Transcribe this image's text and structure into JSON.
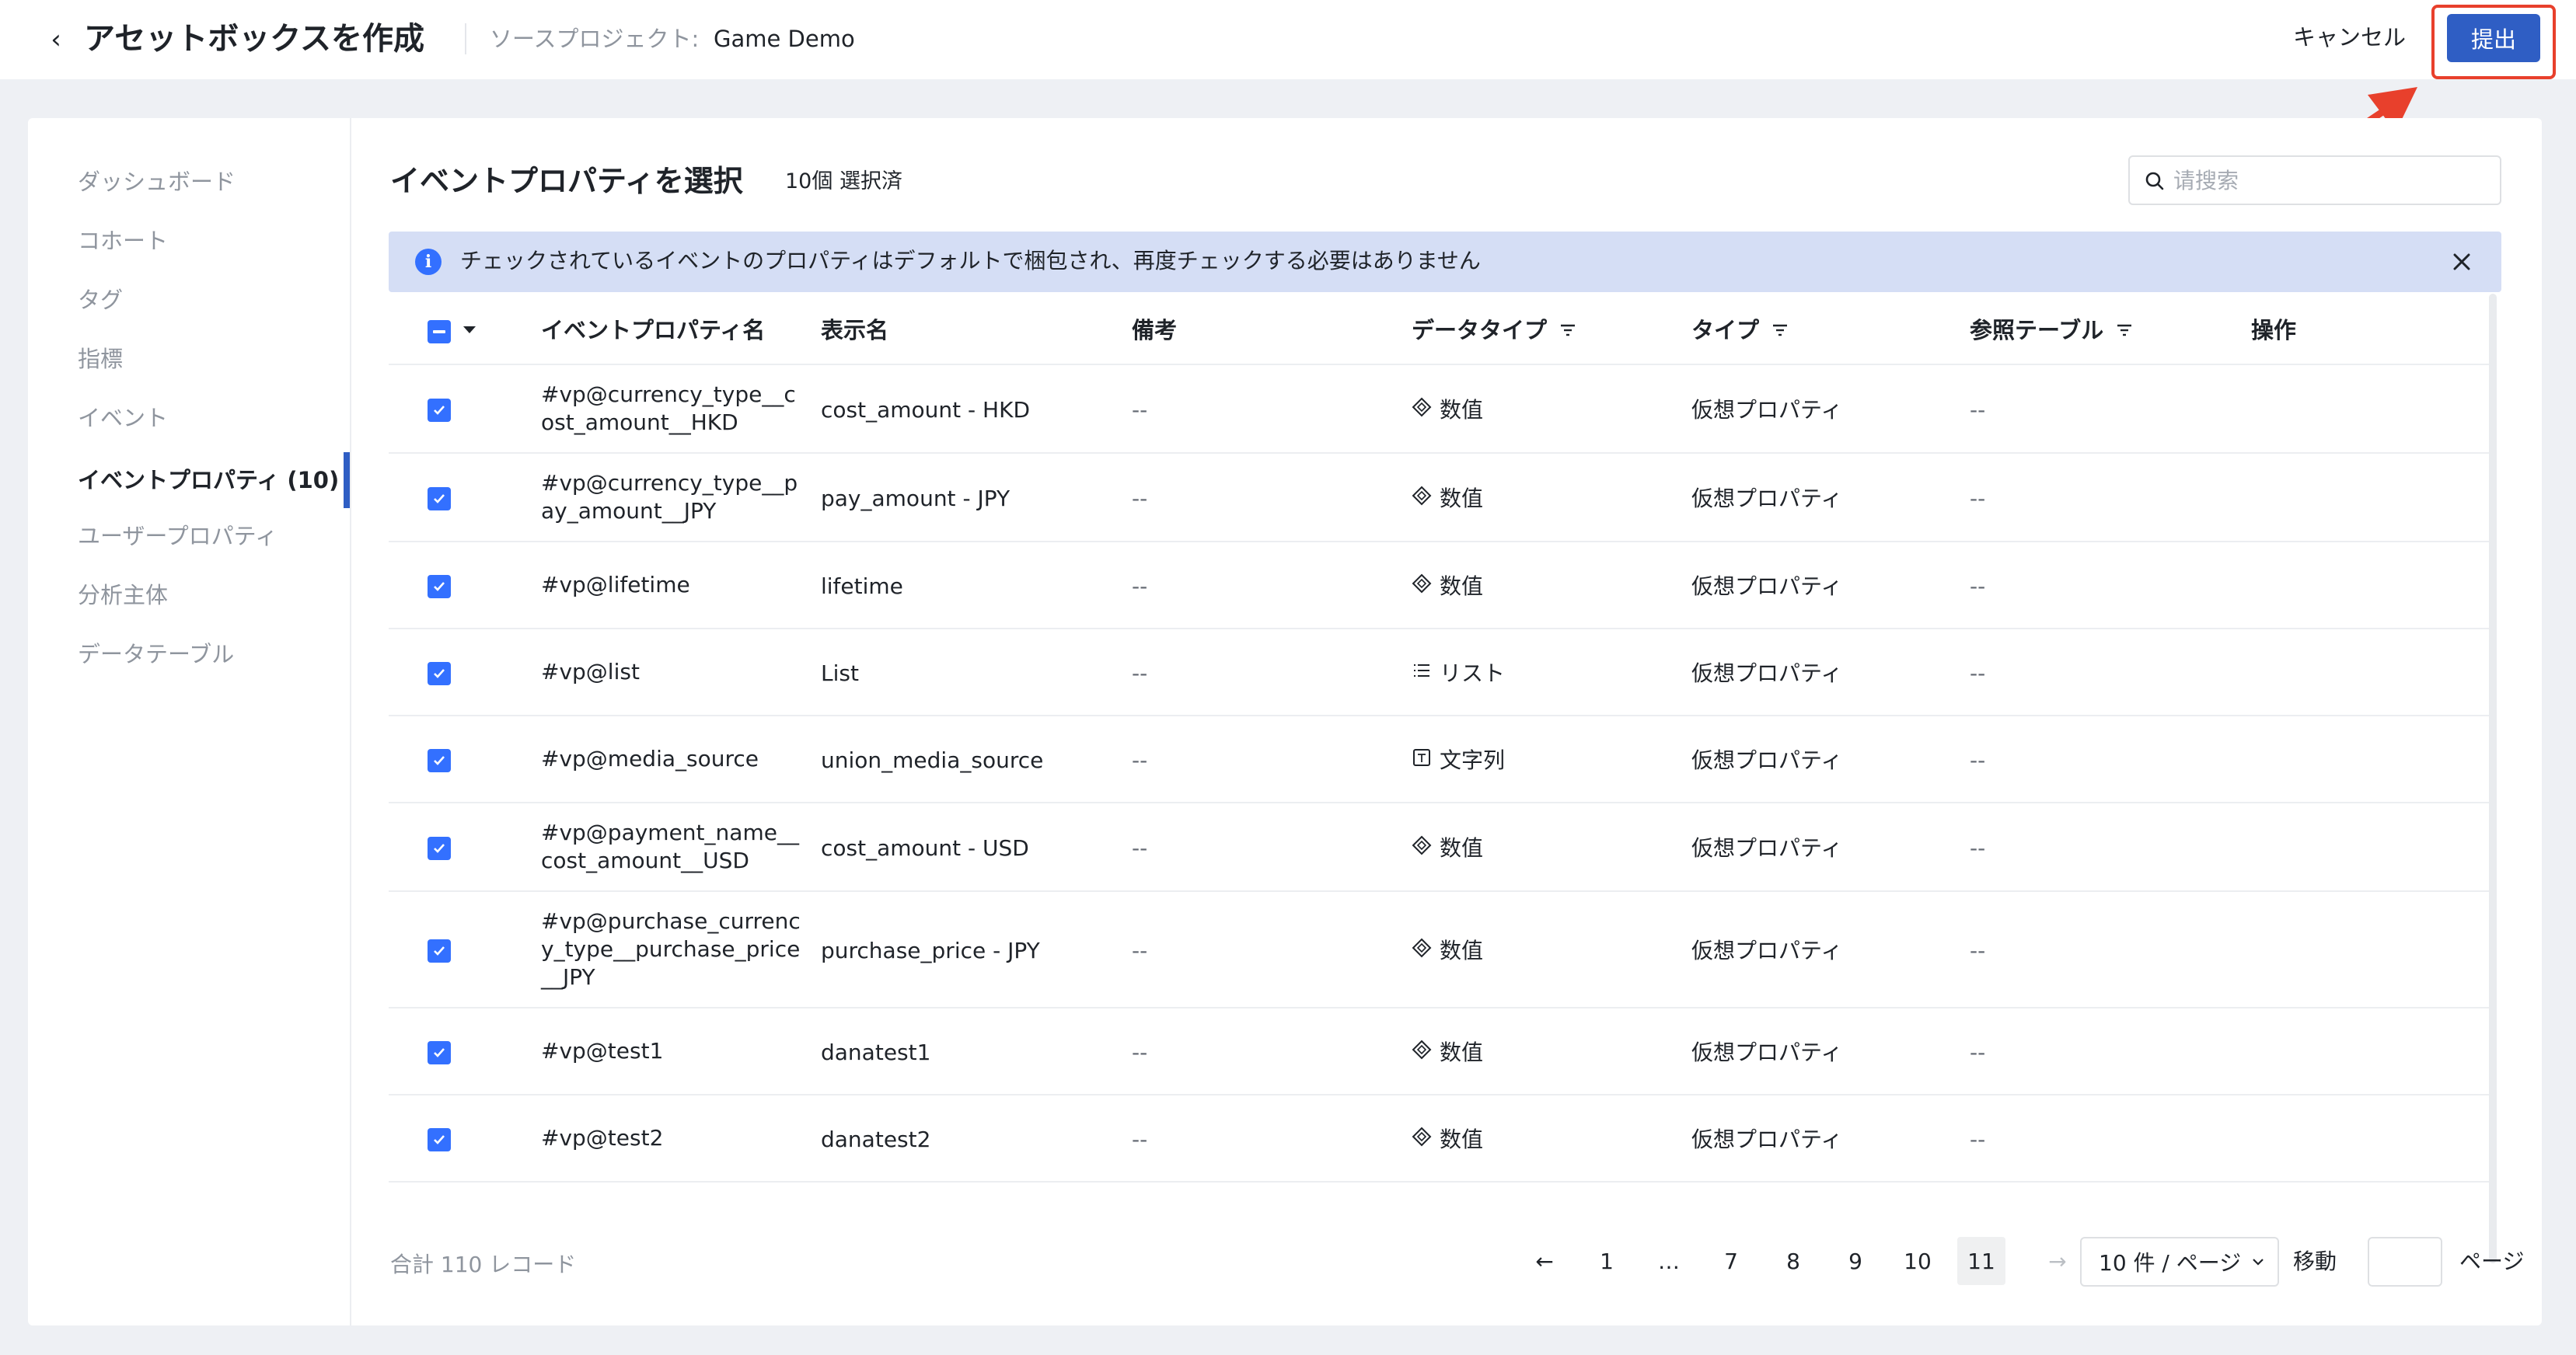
{
  "header": {
    "title": "アセットボックスを作成",
    "source_label": "ソースプロジェクト:",
    "source_value": "Game Demo",
    "cancel_label": "キャンセル",
    "submit_label": "提出"
  },
  "sidebar": {
    "items": [
      {
        "label": "ダッシュボード"
      },
      {
        "label": "コホート"
      },
      {
        "label": "タグ"
      },
      {
        "label": "指標"
      },
      {
        "label": "イベント"
      },
      {
        "label": "イベントプロパティ (10)"
      },
      {
        "label": "ユーザープロパティ"
      },
      {
        "label": "分析主体"
      },
      {
        "label": "データテーブル"
      }
    ],
    "active_index": 5
  },
  "content": {
    "title": "イベントプロパティを選択",
    "selected_count": "10個 選択済",
    "search_placeholder": "请搜索",
    "banner_text": "チェックされているイベントのプロパティはデフォルトで梱包され、再度チェックする必要はありません"
  },
  "table": {
    "headers": {
      "name": "イベントプロパティ名",
      "display": "表示名",
      "remark": "備考",
      "data_type": "データタイプ",
      "type": "タイプ",
      "ref_table": "参照テーブル",
      "action": "操作"
    },
    "rows": [
      {
        "name": "#vp@currency_type__cost_amount__HKD",
        "display": "cost_amount - HKD",
        "remark": "--",
        "data_type": "数值",
        "data_type_icon": "diamond-icon",
        "type": "仮想プロパティ",
        "ref": "--",
        "checked": true
      },
      {
        "name": "#vp@currency_type__pay_amount__JPY",
        "display": "pay_amount - JPY",
        "remark": "--",
        "data_type": "数值",
        "data_type_icon": "diamond-icon",
        "type": "仮想プロパティ",
        "ref": "--",
        "checked": true
      },
      {
        "name": "#vp@lifetime",
        "display": "lifetime",
        "remark": "--",
        "data_type": "数值",
        "data_type_icon": "diamond-icon",
        "type": "仮想プロパティ",
        "ref": "--",
        "checked": true
      },
      {
        "name": "#vp@list",
        "display": "List",
        "remark": "--",
        "data_type": "リスト",
        "data_type_icon": "list-icon",
        "type": "仮想プロパティ",
        "ref": "--",
        "checked": true
      },
      {
        "name": "#vp@media_source",
        "display": "union_media_source",
        "remark": "--",
        "data_type": "文字列",
        "data_type_icon": "text-icon",
        "type": "仮想プロパティ",
        "ref": "--",
        "checked": true
      },
      {
        "name": "#vp@payment_name__cost_amount__USD",
        "display": "cost_amount - USD",
        "remark": "--",
        "data_type": "数值",
        "data_type_icon": "diamond-icon",
        "type": "仮想プロパティ",
        "ref": "--",
        "checked": true
      },
      {
        "name": "#vp@purchase_currency_type__purchase_price__JPY",
        "display": "purchase_price - JPY",
        "remark": "--",
        "data_type": "数值",
        "data_type_icon": "diamond-icon",
        "type": "仮想プロパティ",
        "ref": "--",
        "checked": true
      },
      {
        "name": "#vp@test1",
        "display": "danatest1",
        "remark": "--",
        "data_type": "数值",
        "data_type_icon": "diamond-icon",
        "type": "仮想プロパティ",
        "ref": "--",
        "checked": true
      },
      {
        "name": "#vp@test2",
        "display": "danatest2",
        "remark": "--",
        "data_type": "数值",
        "data_type_icon": "diamond-icon",
        "type": "仮想プロパティ",
        "ref": "--",
        "checked": true
      }
    ]
  },
  "pagination": {
    "total": "合計 110 レコード",
    "prev": "←",
    "next": "→",
    "pages": [
      "1",
      "…",
      "7",
      "8",
      "9",
      "10",
      "11"
    ],
    "current": "11",
    "page_size": "10 件 / ページ",
    "jump_label": "移動",
    "jump_value": "",
    "page_suffix": "ページ"
  },
  "colors": {
    "accent": "#2f5ec4",
    "checkbox": "#3370ff",
    "banner_bg": "#d5def5",
    "highlight": "#e8402c"
  }
}
